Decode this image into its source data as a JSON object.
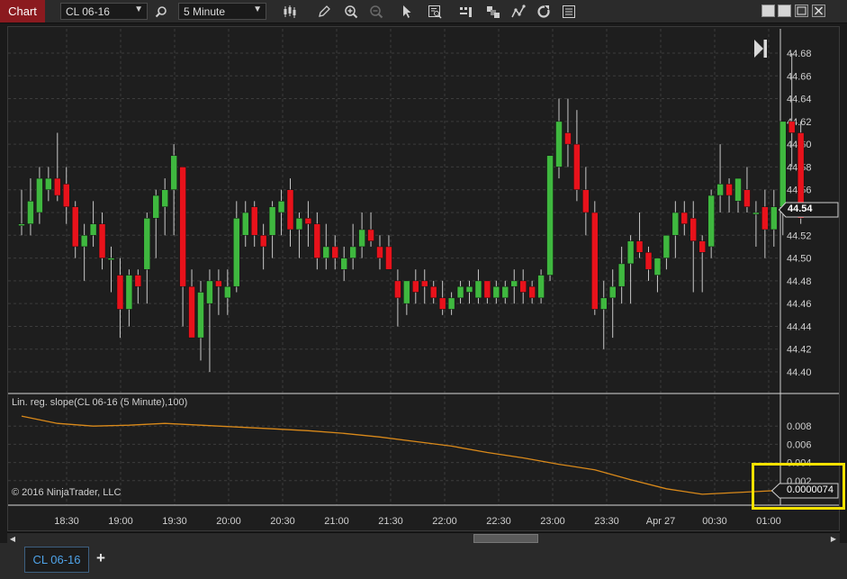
{
  "toolbar": {
    "chart_label": "Chart",
    "instrument": "CL 06-16",
    "interval": "5 Minute",
    "icons": [
      "search-icon",
      "bar-type-icon",
      "drawing-pencil-icon",
      "zoom-in-icon",
      "zoom-out-icon",
      "pointer-icon",
      "data-box-icon",
      "strategies-icon",
      "indicators-icon",
      "drawing-tools-icon",
      "reload-icon",
      "properties-icon"
    ]
  },
  "window_controls": [
    "restore-icon",
    "minimize-icon",
    "maximize-icon",
    "close-icon"
  ],
  "indicator": {
    "label": "Lin. reg. slope(CL 06-16 (5 Minute),100)",
    "current_value": "0.0000074",
    "color": "#d9891a"
  },
  "copyright": "© 2016 NinjaTrader, LLC",
  "price_marker": "44.54",
  "colors": {
    "up": "#3fb83f",
    "down": "#e8121b",
    "grid": "#3c3c3c",
    "background": "#1e1e1e",
    "highlight": "#f5e100"
  },
  "bottom_tabs": {
    "active": "CL 06-16",
    "add_label": "+"
  },
  "chart_data": [
    {
      "type": "candlestick",
      "title": "CL 06-16 (5 Minute)",
      "price_axis_ticks": [
        "44.40",
        "44.42",
        "44.44",
        "44.46",
        "44.48",
        "44.50",
        "44.52",
        "44.54",
        "44.56",
        "44.58",
        "44.60",
        "44.62",
        "44.64",
        "44.66",
        "44.68"
      ],
      "ylim": [
        44.385,
        44.695
      ],
      "time_axis_ticks": [
        "18:30",
        "19:00",
        "19:30",
        "20:00",
        "20:30",
        "21:00",
        "21:30",
        "22:00",
        "22:30",
        "23:00",
        "23:30",
        "Apr 27",
        "00:30",
        "01:00"
      ],
      "grid": true,
      "candles": [
        {
          "o": 44.53,
          "h": 44.56,
          "l": 44.52,
          "c": 44.53
        },
        {
          "o": 44.53,
          "h": 44.57,
          "l": 44.52,
          "c": 44.55
        },
        {
          "o": 44.54,
          "h": 44.58,
          "l": 44.53,
          "c": 44.57
        },
        {
          "o": 44.56,
          "h": 44.58,
          "l": 44.55,
          "c": 44.57
        },
        {
          "o": 44.57,
          "h": 44.61,
          "l": 44.55,
          "c": 44.555
        },
        {
          "o": 44.565,
          "h": 44.58,
          "l": 44.53,
          "c": 44.545
        },
        {
          "o": 44.545,
          "h": 44.55,
          "l": 44.5,
          "c": 44.51
        },
        {
          "o": 44.51,
          "h": 44.53,
          "l": 44.48,
          "c": 44.52
        },
        {
          "o": 44.52,
          "h": 44.55,
          "l": 44.51,
          "c": 44.53
        },
        {
          "o": 44.53,
          "h": 44.54,
          "l": 44.49,
          "c": 44.5
        },
        {
          "o": 44.5,
          "h": 44.51,
          "l": 44.47,
          "c": 44.5
        },
        {
          "o": 44.485,
          "h": 44.5,
          "l": 44.43,
          "c": 44.455
        },
        {
          "o": 44.455,
          "h": 44.49,
          "l": 44.44,
          "c": 44.485
        },
        {
          "o": 44.485,
          "h": 44.49,
          "l": 44.46,
          "c": 44.475
        },
        {
          "o": 44.49,
          "h": 44.54,
          "l": 44.46,
          "c": 44.535
        },
        {
          "o": 44.535,
          "h": 44.56,
          "l": 44.5,
          "c": 44.555
        },
        {
          "o": 44.545,
          "h": 44.57,
          "l": 44.52,
          "c": 44.56
        },
        {
          "o": 44.56,
          "h": 44.6,
          "l": 44.52,
          "c": 44.59
        },
        {
          "o": 44.58,
          "h": 44.58,
          "l": 44.44,
          "c": 44.475
        },
        {
          "o": 44.475,
          "h": 44.49,
          "l": 44.44,
          "c": 44.43
        },
        {
          "o": 44.43,
          "h": 44.48,
          "l": 44.41,
          "c": 44.47
        },
        {
          "o": 44.46,
          "h": 44.49,
          "l": 44.4,
          "c": 44.48
        },
        {
          "o": 44.48,
          "h": 44.49,
          "l": 44.45,
          "c": 44.475
        },
        {
          "o": 44.465,
          "h": 44.49,
          "l": 44.45,
          "c": 44.475
        },
        {
          "o": 44.475,
          "h": 44.55,
          "l": 44.47,
          "c": 44.535
        },
        {
          "o": 44.52,
          "h": 44.55,
          "l": 44.51,
          "c": 44.54
        },
        {
          "o": 44.545,
          "h": 44.55,
          "l": 44.51,
          "c": 44.52
        },
        {
          "o": 44.52,
          "h": 44.53,
          "l": 44.49,
          "c": 44.51
        },
        {
          "o": 44.52,
          "h": 44.55,
          "l": 44.5,
          "c": 44.545
        },
        {
          "o": 44.54,
          "h": 44.56,
          "l": 44.52,
          "c": 44.55
        },
        {
          "o": 44.56,
          "h": 44.57,
          "l": 44.51,
          "c": 44.525
        },
        {
          "o": 44.525,
          "h": 44.54,
          "l": 44.5,
          "c": 44.535
        },
        {
          "o": 44.535,
          "h": 44.55,
          "l": 44.51,
          "c": 44.53
        },
        {
          "o": 44.53,
          "h": 44.54,
          "l": 44.49,
          "c": 44.5
        },
        {
          "o": 44.5,
          "h": 44.53,
          "l": 44.49,
          "c": 44.51
        },
        {
          "o": 44.51,
          "h": 44.52,
          "l": 44.49,
          "c": 44.5
        },
        {
          "o": 44.49,
          "h": 44.51,
          "l": 44.48,
          "c": 44.5
        },
        {
          "o": 44.5,
          "h": 44.53,
          "l": 44.49,
          "c": 44.51
        },
        {
          "o": 44.51,
          "h": 44.54,
          "l": 44.5,
          "c": 44.525
        },
        {
          "o": 44.525,
          "h": 44.54,
          "l": 44.51,
          "c": 44.515
        },
        {
          "o": 44.51,
          "h": 44.52,
          "l": 44.49,
          "c": 44.5
        },
        {
          "o": 44.51,
          "h": 44.52,
          "l": 44.49,
          "c": 44.49
        },
        {
          "o": 44.48,
          "h": 44.49,
          "l": 44.44,
          "c": 44.465
        },
        {
          "o": 44.46,
          "h": 44.48,
          "l": 44.45,
          "c": 44.48
        },
        {
          "o": 44.48,
          "h": 44.49,
          "l": 44.46,
          "c": 44.47
        },
        {
          "o": 44.48,
          "h": 44.49,
          "l": 44.46,
          "c": 44.475
        },
        {
          "o": 44.475,
          "h": 44.48,
          "l": 44.46,
          "c": 44.465
        },
        {
          "o": 44.465,
          "h": 44.48,
          "l": 44.45,
          "c": 44.455
        },
        {
          "o": 44.455,
          "h": 44.47,
          "l": 44.45,
          "c": 44.465
        },
        {
          "o": 44.465,
          "h": 44.48,
          "l": 44.46,
          "c": 44.475
        },
        {
          "o": 44.47,
          "h": 44.48,
          "l": 44.46,
          "c": 44.475
        },
        {
          "o": 44.465,
          "h": 44.49,
          "l": 44.46,
          "c": 44.48
        },
        {
          "o": 44.48,
          "h": 44.48,
          "l": 44.46,
          "c": 44.465
        },
        {
          "o": 44.465,
          "h": 44.48,
          "l": 44.46,
          "c": 44.475
        },
        {
          "o": 44.465,
          "h": 44.48,
          "l": 44.46,
          "c": 44.475
        },
        {
          "o": 44.475,
          "h": 44.49,
          "l": 44.46,
          "c": 44.48
        },
        {
          "o": 44.48,
          "h": 44.49,
          "l": 44.46,
          "c": 44.47
        },
        {
          "o": 44.475,
          "h": 44.48,
          "l": 44.46,
          "c": 44.465
        },
        {
          "o": 44.465,
          "h": 44.49,
          "l": 44.46,
          "c": 44.485
        },
        {
          "o": 44.485,
          "h": 44.59,
          "l": 44.48,
          "c": 44.59
        },
        {
          "o": 44.58,
          "h": 44.64,
          "l": 44.57,
          "c": 44.62
        },
        {
          "o": 44.61,
          "h": 44.64,
          "l": 44.58,
          "c": 44.6
        },
        {
          "o": 44.6,
          "h": 44.63,
          "l": 44.55,
          "c": 44.56
        },
        {
          "o": 44.56,
          "h": 44.58,
          "l": 44.52,
          "c": 44.54
        },
        {
          "o": 44.54,
          "h": 44.55,
          "l": 44.45,
          "c": 44.455
        },
        {
          "o": 44.455,
          "h": 44.48,
          "l": 44.42,
          "c": 44.465
        },
        {
          "o": 44.465,
          "h": 44.49,
          "l": 44.43,
          "c": 44.475
        },
        {
          "o": 44.475,
          "h": 44.51,
          "l": 44.46,
          "c": 44.495
        },
        {
          "o": 44.495,
          "h": 44.52,
          "l": 44.46,
          "c": 44.515
        },
        {
          "o": 44.515,
          "h": 44.54,
          "l": 44.5,
          "c": 44.505
        },
        {
          "o": 44.505,
          "h": 44.51,
          "l": 44.48,
          "c": 44.49
        },
        {
          "o": 44.485,
          "h": 44.5,
          "l": 44.47,
          "c": 44.5
        },
        {
          "o": 44.5,
          "h": 44.52,
          "l": 44.49,
          "c": 44.52
        },
        {
          "o": 44.52,
          "h": 44.55,
          "l": 44.5,
          "c": 44.54
        },
        {
          "o": 44.54,
          "h": 44.55,
          "l": 44.52,
          "c": 44.53
        },
        {
          "o": 44.535,
          "h": 44.55,
          "l": 44.47,
          "c": 44.515
        },
        {
          "o": 44.515,
          "h": 44.52,
          "l": 44.47,
          "c": 44.505
        },
        {
          "o": 44.51,
          "h": 44.56,
          "l": 44.5,
          "c": 44.555
        },
        {
          "o": 44.555,
          "h": 44.6,
          "l": 44.54,
          "c": 44.565
        },
        {
          "o": 44.565,
          "h": 44.57,
          "l": 44.54,
          "c": 44.555
        },
        {
          "o": 44.55,
          "h": 44.57,
          "l": 44.54,
          "c": 44.57
        },
        {
          "o": 44.56,
          "h": 44.58,
          "l": 44.54,
          "c": 44.545
        },
        {
          "o": 44.54,
          "h": 44.55,
          "l": 44.51,
          "c": 44.54
        },
        {
          "o": 44.545,
          "h": 44.56,
          "l": 44.5,
          "c": 44.525
        },
        {
          "o": 44.525,
          "h": 44.56,
          "l": 44.51,
          "c": 44.545
        },
        {
          "o": 44.545,
          "h": 44.62,
          "l": 44.52,
          "c": 44.62
        },
        {
          "o": 44.62,
          "h": 44.68,
          "l": 44.58,
          "c": 44.61
        },
        {
          "o": 44.61,
          "h": 44.62,
          "l": 44.53,
          "c": 44.535
        }
      ]
    },
    {
      "type": "line",
      "title": "Lin. reg. slope(CL 06-16 (5 Minute),100)",
      "y_axis_ticks": [
        "0.002",
        "0.004",
        "0.006",
        "0.008"
      ],
      "ylim": [
        -0.0006,
        0.0103
      ],
      "series": [
        {
          "name": "Lin. reg. slope",
          "x": [
            0,
            4,
            8,
            12,
            16,
            20,
            24,
            28,
            32,
            36,
            40,
            44,
            48,
            52,
            56,
            60,
            64,
            68,
            72,
            76,
            80,
            84,
            87
          ],
          "values": [
            0.0091,
            0.0083,
            0.008,
            0.0081,
            0.0083,
            0.0081,
            0.0079,
            0.0077,
            0.0075,
            0.0072,
            0.0068,
            0.0063,
            0.0058,
            0.0051,
            0.0045,
            0.0038,
            0.0032,
            0.0021,
            0.0011,
            0.0005,
            0.0007,
            0.0009,
            0.0009
          ]
        }
      ]
    }
  ]
}
